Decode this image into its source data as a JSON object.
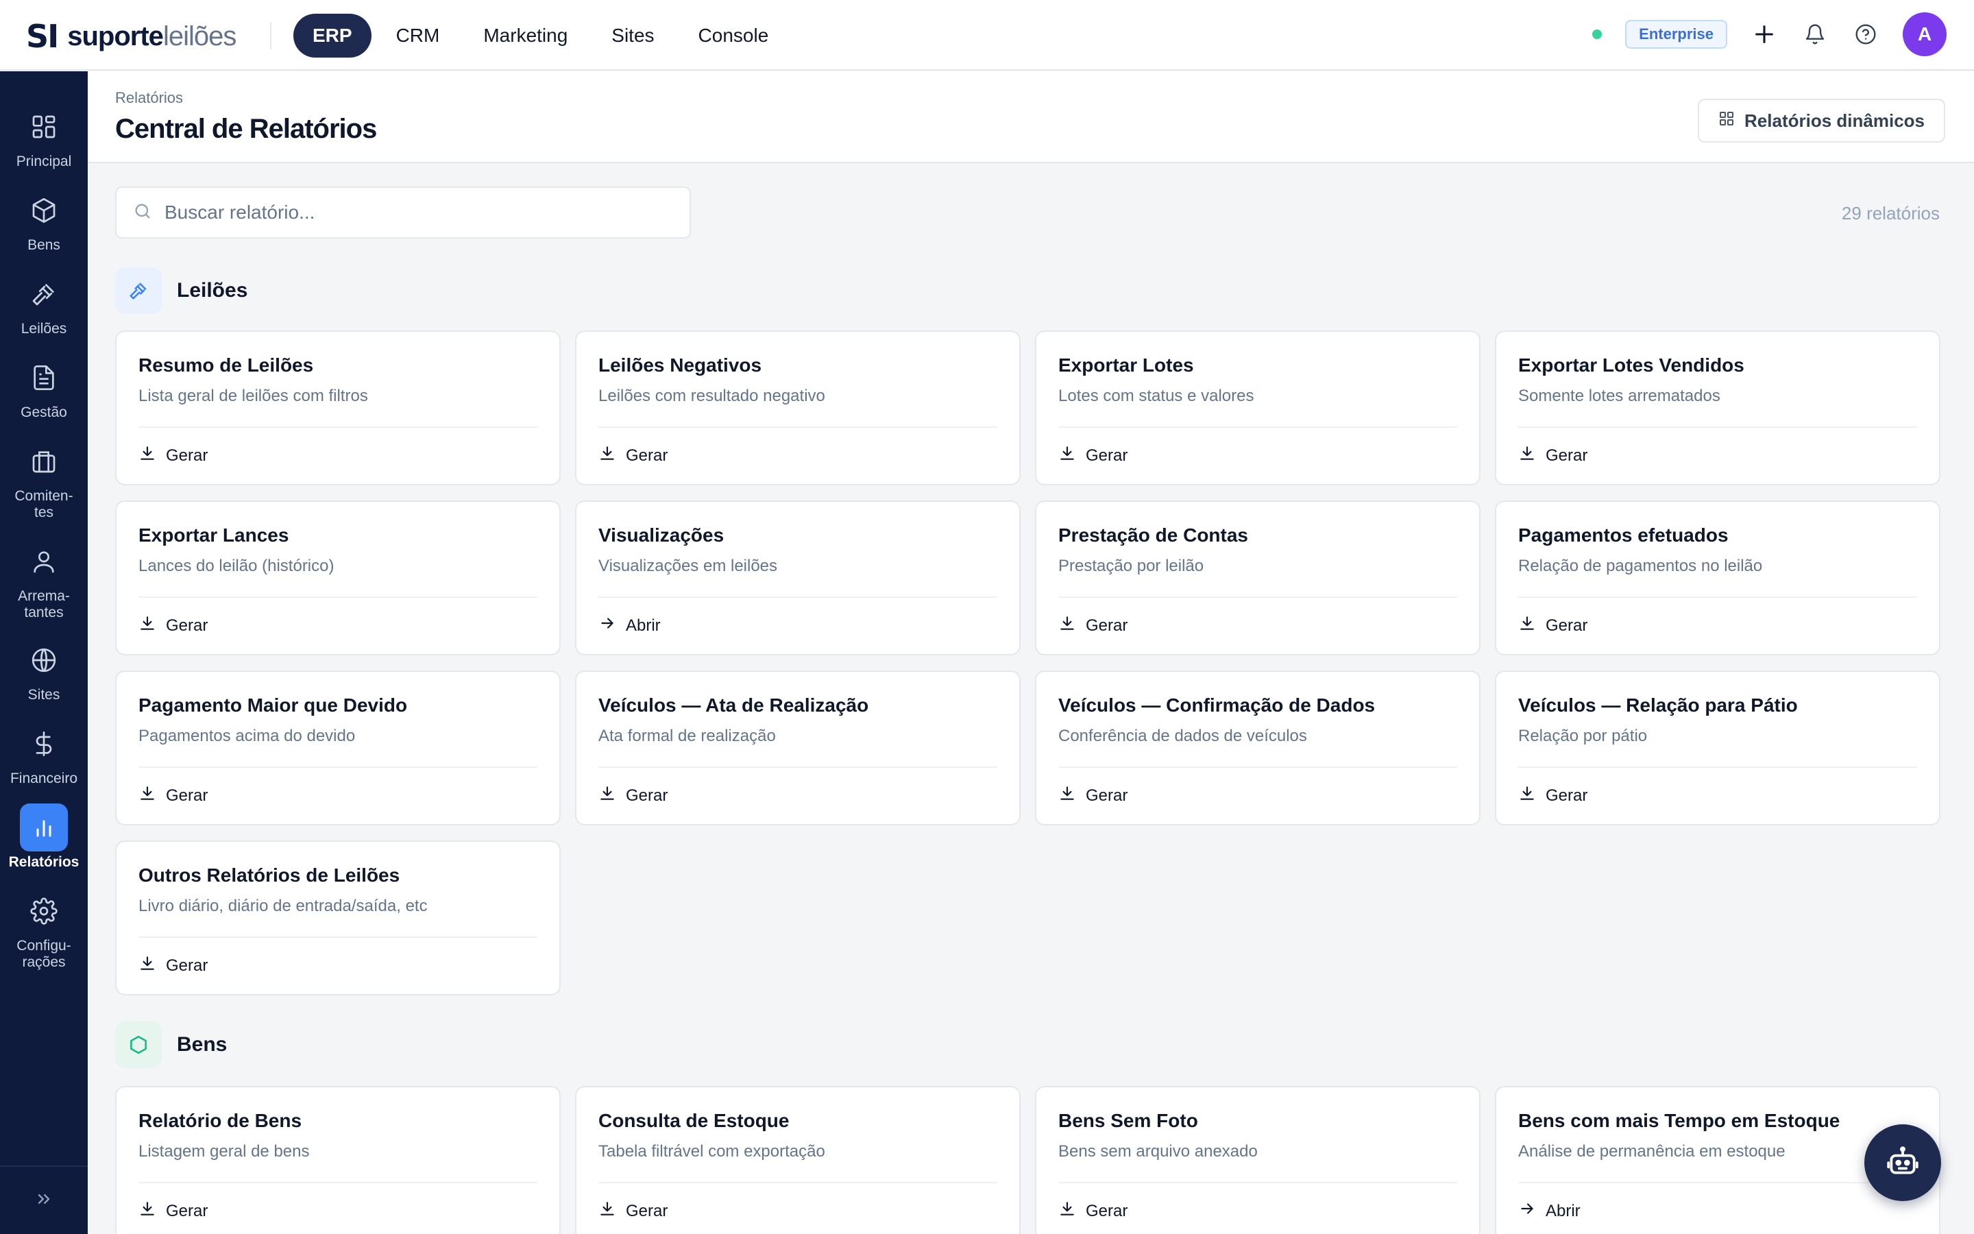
{
  "brand": {
    "mark": "SI",
    "name_bold": "suporte",
    "name_light": "leilões"
  },
  "top_nav": [
    "ERP",
    "CRM",
    "Marketing",
    "Sites",
    "Console"
  ],
  "plan_badge": "Enterprise",
  "user_initial": "A",
  "sidebar": [
    {
      "label": "Principal",
      "icon": "grid-icon"
    },
    {
      "label": "Bens",
      "icon": "box-icon"
    },
    {
      "label": "Leilões",
      "icon": "gavel-icon"
    },
    {
      "label": "Gestão",
      "icon": "document-icon"
    },
    {
      "label": "Comiten-\ntes",
      "icon": "briefcase-icon"
    },
    {
      "label": "Arrema-\ntantes",
      "icon": "user-icon"
    },
    {
      "label": "Sites",
      "icon": "globe-icon"
    },
    {
      "label": "Financeiro",
      "icon": "dollar-icon"
    },
    {
      "label": "Relatórios",
      "icon": "bar-chart-icon",
      "active": true
    },
    {
      "label": "Configu-\nrações",
      "icon": "gear-icon"
    }
  ],
  "breadcrumb": "Relatórios",
  "page_title": "Central de Relatórios",
  "dynamic_reports_button": "Relatórios dinâmicos",
  "search": {
    "placeholder": "Buscar relatório...",
    "value": ""
  },
  "report_count": "29 relatórios",
  "sections": [
    {
      "title": "Leilões",
      "icon": "gavel-icon",
      "icon_color": "#3b82f6",
      "icon_bg": "#eaf1fe",
      "cards": [
        {
          "title": "Resumo de Leilões",
          "desc": "Lista geral de leilões com filtros",
          "action": "Gerar"
        },
        {
          "title": "Leilões Negativos",
          "desc": "Leilões com resultado negativo",
          "action": "Gerar"
        },
        {
          "title": "Exportar Lotes",
          "desc": "Lotes com status e valores",
          "action": "Gerar"
        },
        {
          "title": "Exportar Lotes Vendidos",
          "desc": "Somente lotes arrematados",
          "action": "Gerar"
        },
        {
          "title": "Exportar Lances",
          "desc": "Lances do leilão (histórico)",
          "action": "Gerar"
        },
        {
          "title": "Visualizações",
          "desc": "Visualizações em leilões",
          "action": "Abrir"
        },
        {
          "title": "Prestação de Contas",
          "desc": "Prestação por leilão",
          "action": "Gerar"
        },
        {
          "title": "Pagamentos efetuados",
          "desc": "Relação de pagamentos no leilão",
          "action": "Gerar"
        },
        {
          "title": "Pagamento Maior que Devido",
          "desc": "Pagamentos acima do devido",
          "action": "Gerar"
        },
        {
          "title": "Veículos — Ata de Realização",
          "desc": "Ata formal de realização",
          "action": "Gerar"
        },
        {
          "title": "Veículos — Confirmação de Dados",
          "desc": "Conferência de dados de veículos",
          "action": "Gerar"
        },
        {
          "title": "Veículos — Relação para Pátio",
          "desc": "Relação por pátio",
          "action": "Gerar"
        },
        {
          "title": "Outros Relatórios de Leilões",
          "desc": "Livro diário, diário de entrada/saída, etc",
          "action": "Gerar"
        }
      ]
    },
    {
      "title": "Bens",
      "icon": "hexagon-icon",
      "icon_color": "#10b981",
      "icon_bg": "#e6f6ef",
      "cards": [
        {
          "title": "Relatório de Bens",
          "desc": "Listagem geral de bens",
          "action": "Gerar"
        },
        {
          "title": "Consulta de Estoque",
          "desc": "Tabela filtrável com exportação",
          "action": "Gerar"
        },
        {
          "title": "Bens Sem Foto",
          "desc": "Bens sem arquivo anexado",
          "action": "Gerar"
        },
        {
          "title": "Bens com mais Tempo em Estoque",
          "desc": "Análise de permanência em estoque",
          "action": "Abrir"
        }
      ]
    }
  ]
}
